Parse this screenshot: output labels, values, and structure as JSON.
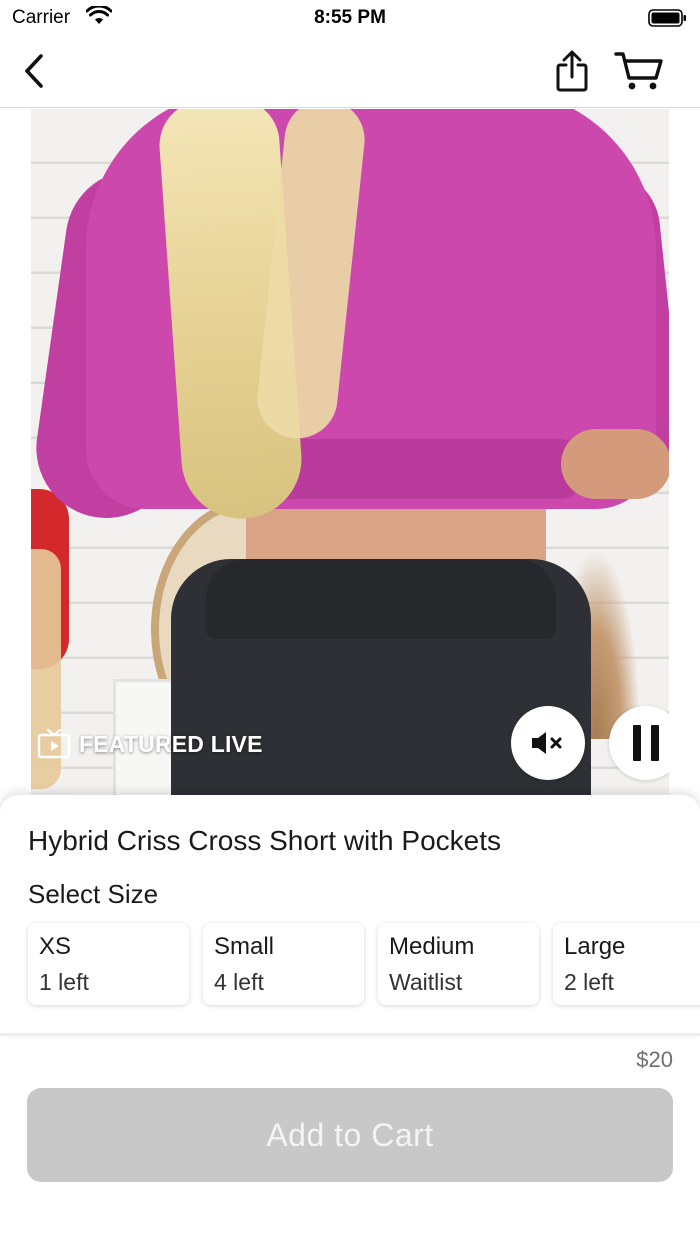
{
  "status_bar": {
    "carrier": "Carrier",
    "time": "8:55 PM"
  },
  "nav": {
    "back_icon": "chevron-left-icon",
    "share_icon": "share-icon",
    "cart_icon": "cart-icon"
  },
  "video": {
    "badge_label": "FEATURED LIVE",
    "badge_icon": "tv-play-icon",
    "mute_icon": "speaker-muted-icon",
    "pause_icon": "pause-icon"
  },
  "product": {
    "title": "Hybrid Criss Cross Short with Pockets",
    "size_heading": "Select Size",
    "sizes": [
      {
        "name": "XS",
        "stock": "1 left"
      },
      {
        "name": "Small",
        "stock": "4 left"
      },
      {
        "name": "Medium",
        "stock": "Waitlist"
      },
      {
        "name": "Large",
        "stock": "2 left"
      }
    ],
    "price": "$20",
    "add_to_cart_label": "Add to Cart"
  },
  "colors": {
    "button_disabled": "#c8c8c8",
    "sweater": "#cc48ad"
  }
}
